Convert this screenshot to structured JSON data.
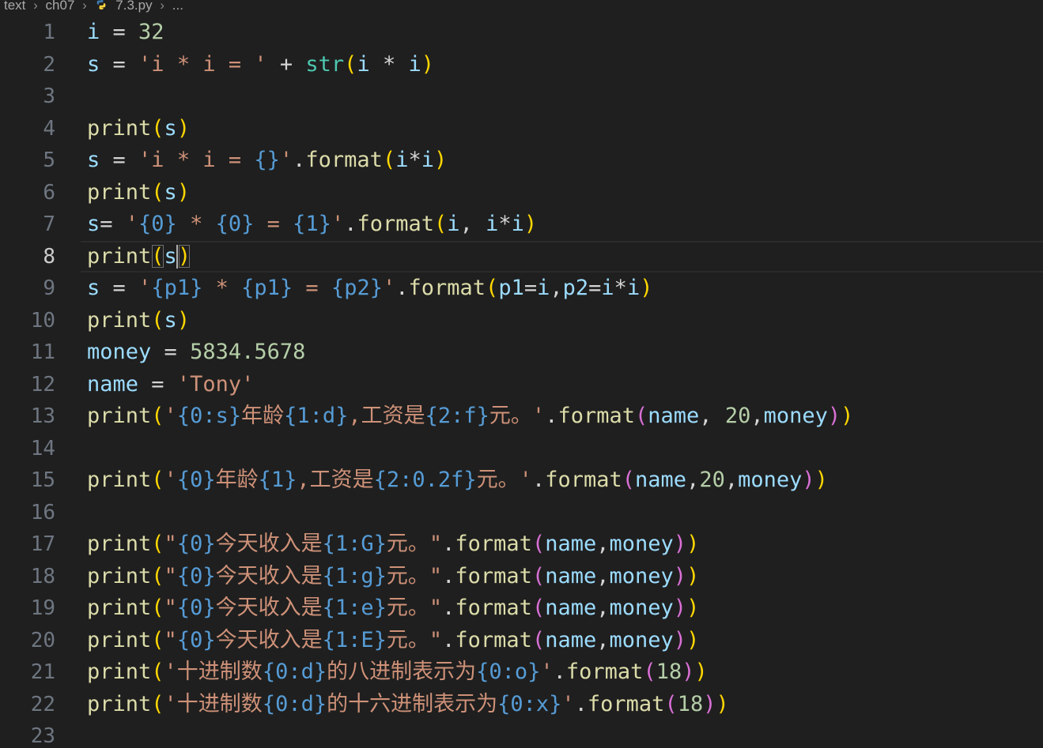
{
  "breadcrumb": {
    "items": [
      "text",
      "ch07",
      "7.3.py",
      "..."
    ]
  },
  "editor": {
    "current_line": 8,
    "lines": [
      {
        "number": "1",
        "tokens": [
          [
            "i",
            "var"
          ],
          [
            " = ",
            "op"
          ],
          [
            "32",
            "num"
          ]
        ]
      },
      {
        "number": "2",
        "tokens": [
          [
            "s",
            "var"
          ],
          [
            " = ",
            "op"
          ],
          [
            "'i * i = '",
            "str"
          ],
          [
            " + ",
            "op"
          ],
          [
            "str",
            "cls"
          ],
          [
            "(",
            "p1"
          ],
          [
            "i",
            "var"
          ],
          [
            " * ",
            "op"
          ],
          [
            "i",
            "var"
          ],
          [
            ")",
            "p1"
          ]
        ]
      },
      {
        "number": "3",
        "tokens": []
      },
      {
        "number": "4",
        "tokens": [
          [
            "print",
            "fn"
          ],
          [
            "(",
            "p1"
          ],
          [
            "s",
            "var"
          ],
          [
            ")",
            "p1"
          ]
        ]
      },
      {
        "number": "5",
        "tokens": [
          [
            "s",
            "var"
          ],
          [
            " = ",
            "op"
          ],
          [
            "'i * i = ",
            "str"
          ],
          [
            "{}",
            "ph"
          ],
          [
            "'",
            "str"
          ],
          [
            ".",
            "plain"
          ],
          [
            "format",
            "fn"
          ],
          [
            "(",
            "p1"
          ],
          [
            "i",
            "var"
          ],
          [
            "*",
            "op"
          ],
          [
            "i",
            "var"
          ],
          [
            ")",
            "p1"
          ]
        ]
      },
      {
        "number": "6",
        "tokens": [
          [
            "print",
            "fn"
          ],
          [
            "(",
            "p1"
          ],
          [
            "s",
            "var"
          ],
          [
            ")",
            "p1"
          ]
        ]
      },
      {
        "number": "7",
        "tokens": [
          [
            "s",
            "var"
          ],
          [
            "= ",
            "op"
          ],
          [
            "'",
            "str"
          ],
          [
            "{0}",
            "ph"
          ],
          [
            " * ",
            "str"
          ],
          [
            "{0}",
            "ph"
          ],
          [
            " = ",
            "str"
          ],
          [
            "{1}",
            "ph"
          ],
          [
            "'",
            "str"
          ],
          [
            ".",
            "plain"
          ],
          [
            "format",
            "fn"
          ],
          [
            "(",
            "p1"
          ],
          [
            "i",
            "var"
          ],
          [
            ", ",
            "plain"
          ],
          [
            "i",
            "var"
          ],
          [
            "*",
            "op"
          ],
          [
            "i",
            "var"
          ],
          [
            ")",
            "p1"
          ]
        ]
      },
      {
        "number": "8",
        "tokens": [
          [
            "print",
            "fn"
          ],
          [
            "(",
            "p1m"
          ],
          [
            "s",
            "var"
          ],
          [
            ")",
            "p1m"
          ]
        ]
      },
      {
        "number": "9",
        "tokens": [
          [
            "s",
            "var"
          ],
          [
            " = ",
            "op"
          ],
          [
            "'",
            "str"
          ],
          [
            "{p1}",
            "ph"
          ],
          [
            " * ",
            "str"
          ],
          [
            "{p1}",
            "ph"
          ],
          [
            " = ",
            "str"
          ],
          [
            "{p2}",
            "ph"
          ],
          [
            "'",
            "str"
          ],
          [
            ".",
            "plain"
          ],
          [
            "format",
            "fn"
          ],
          [
            "(",
            "p1"
          ],
          [
            "p1",
            "var"
          ],
          [
            "=",
            "op"
          ],
          [
            "i",
            "var"
          ],
          [
            ",",
            "plain"
          ],
          [
            "p2",
            "var"
          ],
          [
            "=",
            "op"
          ],
          [
            "i",
            "var"
          ],
          [
            "*",
            "op"
          ],
          [
            "i",
            "var"
          ],
          [
            ")",
            "p1"
          ]
        ]
      },
      {
        "number": "10",
        "tokens": [
          [
            "print",
            "fn"
          ],
          [
            "(",
            "p1"
          ],
          [
            "s",
            "var"
          ],
          [
            ")",
            "p1"
          ]
        ]
      },
      {
        "number": "11",
        "tokens": [
          [
            "money",
            "var"
          ],
          [
            " = ",
            "op"
          ],
          [
            "5834.5678",
            "num"
          ]
        ]
      },
      {
        "number": "12",
        "tokens": [
          [
            "name",
            "var"
          ],
          [
            " = ",
            "op"
          ],
          [
            "'Tony'",
            "str"
          ]
        ]
      },
      {
        "number": "13",
        "tokens": [
          [
            "print",
            "fn"
          ],
          [
            "(",
            "p1"
          ],
          [
            "'",
            "str"
          ],
          [
            "{0:s}",
            "ph"
          ],
          [
            "年龄",
            "str"
          ],
          [
            "{1:d}",
            "ph"
          ],
          [
            ",工资是",
            "str"
          ],
          [
            "{2:f}",
            "ph"
          ],
          [
            "元。'",
            "str"
          ],
          [
            ".",
            "plain"
          ],
          [
            "format",
            "fn"
          ],
          [
            "(",
            "p2"
          ],
          [
            "name",
            "var"
          ],
          [
            ", ",
            "plain"
          ],
          [
            "20",
            "num"
          ],
          [
            ",",
            "plain"
          ],
          [
            "money",
            "var"
          ],
          [
            ")",
            "p2"
          ],
          [
            ")",
            "p1"
          ]
        ]
      },
      {
        "number": "14",
        "tokens": []
      },
      {
        "number": "15",
        "tokens": [
          [
            "print",
            "fn"
          ],
          [
            "(",
            "p1"
          ],
          [
            "'",
            "str"
          ],
          [
            "{0}",
            "ph"
          ],
          [
            "年龄",
            "str"
          ],
          [
            "{1}",
            "ph"
          ],
          [
            ",工资是",
            "str"
          ],
          [
            "{2:0.2f}",
            "ph"
          ],
          [
            "元。'",
            "str"
          ],
          [
            ".",
            "plain"
          ],
          [
            "format",
            "fn"
          ],
          [
            "(",
            "p2"
          ],
          [
            "name",
            "var"
          ],
          [
            ",",
            "plain"
          ],
          [
            "20",
            "num"
          ],
          [
            ",",
            "plain"
          ],
          [
            "money",
            "var"
          ],
          [
            ")",
            "p2"
          ],
          [
            ")",
            "p1"
          ]
        ]
      },
      {
        "number": "16",
        "tokens": []
      },
      {
        "number": "17",
        "tokens": [
          [
            "print",
            "fn"
          ],
          [
            "(",
            "p1"
          ],
          [
            "\"",
            "str"
          ],
          [
            "{0}",
            "ph"
          ],
          [
            "今天收入是",
            "str"
          ],
          [
            "{1:G}",
            "ph"
          ],
          [
            "元。\"",
            "str"
          ],
          [
            ".",
            "plain"
          ],
          [
            "format",
            "fn"
          ],
          [
            "(",
            "p2"
          ],
          [
            "name",
            "var"
          ],
          [
            ",",
            "plain"
          ],
          [
            "money",
            "var"
          ],
          [
            ")",
            "p2"
          ],
          [
            ")",
            "p1"
          ]
        ]
      },
      {
        "number": "18",
        "tokens": [
          [
            "print",
            "fn"
          ],
          [
            "(",
            "p1"
          ],
          [
            "\"",
            "str"
          ],
          [
            "{0}",
            "ph"
          ],
          [
            "今天收入是",
            "str"
          ],
          [
            "{1:g}",
            "ph"
          ],
          [
            "元。\"",
            "str"
          ],
          [
            ".",
            "plain"
          ],
          [
            "format",
            "fn"
          ],
          [
            "(",
            "p2"
          ],
          [
            "name",
            "var"
          ],
          [
            ",",
            "plain"
          ],
          [
            "money",
            "var"
          ],
          [
            ")",
            "p2"
          ],
          [
            ")",
            "p1"
          ]
        ]
      },
      {
        "number": "19",
        "tokens": [
          [
            "print",
            "fn"
          ],
          [
            "(",
            "p1"
          ],
          [
            "\"",
            "str"
          ],
          [
            "{0}",
            "ph"
          ],
          [
            "今天收入是",
            "str"
          ],
          [
            "{1:e}",
            "ph"
          ],
          [
            "元。\"",
            "str"
          ],
          [
            ".",
            "plain"
          ],
          [
            "format",
            "fn"
          ],
          [
            "(",
            "p2"
          ],
          [
            "name",
            "var"
          ],
          [
            ",",
            "plain"
          ],
          [
            "money",
            "var"
          ],
          [
            ")",
            "p2"
          ],
          [
            ")",
            "p1"
          ]
        ]
      },
      {
        "number": "20",
        "tokens": [
          [
            "print",
            "fn"
          ],
          [
            "(",
            "p1"
          ],
          [
            "\"",
            "str"
          ],
          [
            "{0}",
            "ph"
          ],
          [
            "今天收入是",
            "str"
          ],
          [
            "{1:E}",
            "ph"
          ],
          [
            "元。\"",
            "str"
          ],
          [
            ".",
            "plain"
          ],
          [
            "format",
            "fn"
          ],
          [
            "(",
            "p2"
          ],
          [
            "name",
            "var"
          ],
          [
            ",",
            "plain"
          ],
          [
            "money",
            "var"
          ],
          [
            ")",
            "p2"
          ],
          [
            ")",
            "p1"
          ]
        ]
      },
      {
        "number": "21",
        "tokens": [
          [
            "print",
            "fn"
          ],
          [
            "(",
            "p1"
          ],
          [
            "'十进制数",
            "str"
          ],
          [
            "{0:d}",
            "ph"
          ],
          [
            "的八进制表示为",
            "str"
          ],
          [
            "{0:o}",
            "ph"
          ],
          [
            "'",
            "str"
          ],
          [
            ".",
            "plain"
          ],
          [
            "format",
            "fn"
          ],
          [
            "(",
            "p2"
          ],
          [
            "18",
            "num"
          ],
          [
            ")",
            "p2"
          ],
          [
            ")",
            "p1"
          ]
        ]
      },
      {
        "number": "22",
        "tokens": [
          [
            "print",
            "fn"
          ],
          [
            "(",
            "p1"
          ],
          [
            "'十进制数",
            "str"
          ],
          [
            "{0:d}",
            "ph"
          ],
          [
            "的十六进制表示为",
            "str"
          ],
          [
            "{0:x}",
            "ph"
          ],
          [
            "'",
            "str"
          ],
          [
            ".",
            "plain"
          ],
          [
            "format",
            "fn"
          ],
          [
            "(",
            "p2"
          ],
          [
            "18",
            "num"
          ],
          [
            ")",
            "p2"
          ],
          [
            ")",
            "p1"
          ]
        ]
      },
      {
        "number": "23",
        "tokens": []
      }
    ]
  }
}
